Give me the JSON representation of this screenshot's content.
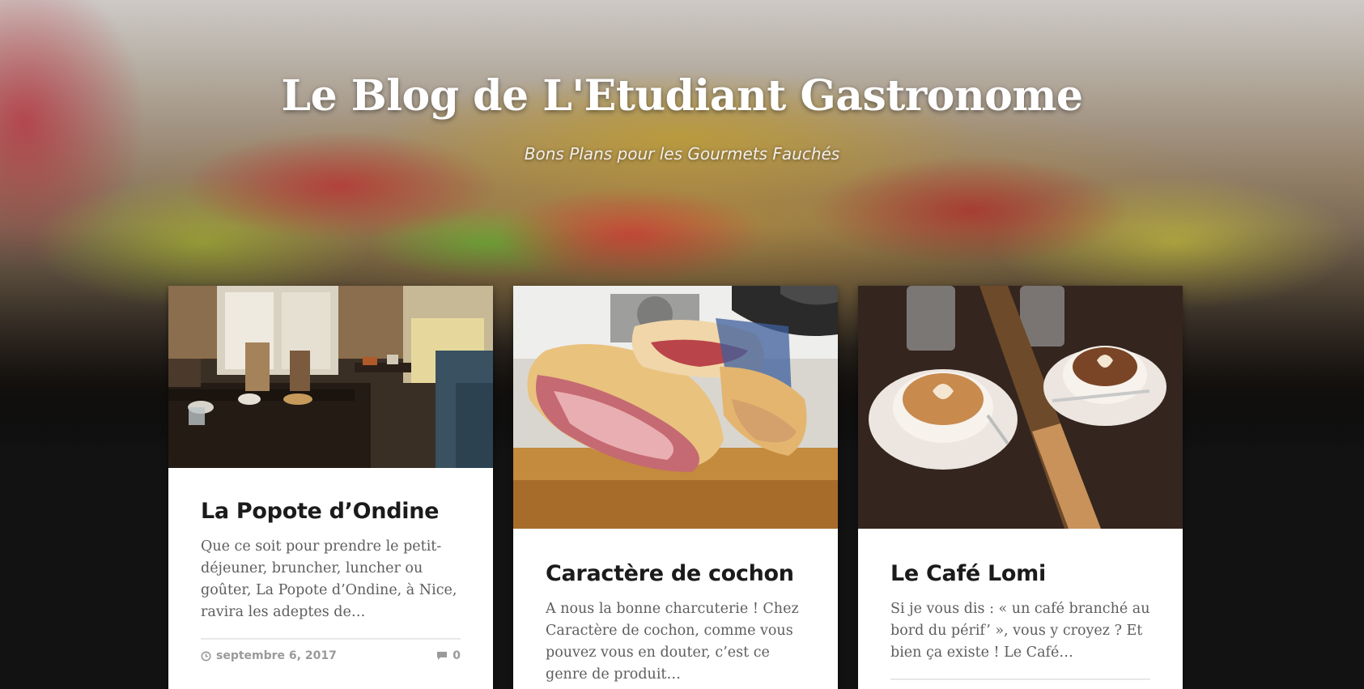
{
  "site": {
    "title": "Le Blog de L'Etudiant Gastronome",
    "tagline": "Bons Plans pour les Gourmets Fauchés"
  },
  "posts": [
    {
      "title": "La Popote d’Ondine",
      "excerpt": "Que ce soit pour prendre le petit-déjeuner, bruncher, luncher ou goûter, La Popote d’Ondine, à Nice, ravira les adeptes de…",
      "date": "septembre 6, 2017",
      "comments": "0",
      "image": "restaurant-interior-photo"
    },
    {
      "title": "Caractère de cochon",
      "excerpt": "A nous la bonne charcuterie ! Chez Caractère de cochon, comme vous pouvez vous en douter, c’est ce genre de produit…",
      "image": "ham-sandwich-photo"
    },
    {
      "title": "Le Café Lomi",
      "excerpt": "Si je vous dis : « un café branché au bord du périf’ », vous y croyez ? Et bien ça existe ! Le Café…",
      "image": "latte-art-cups-photo"
    }
  ],
  "icons": {
    "date": "clock-icon",
    "comments": "comment-bubble-icon"
  }
}
